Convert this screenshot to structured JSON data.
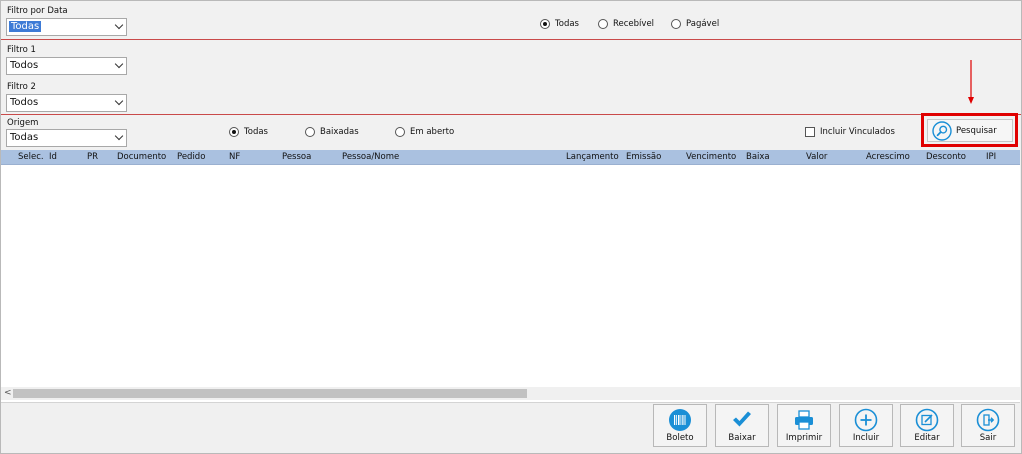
{
  "filters": {
    "filtro_data": {
      "label": "Filtro por Data",
      "value": "Todas"
    },
    "filtro1": {
      "label": "Filtro 1",
      "value": "Todos"
    },
    "filtro2": {
      "label": "Filtro 2",
      "value": "Todos"
    },
    "origem": {
      "label": "Origem",
      "value": "Todas"
    }
  },
  "tipo_radios": [
    {
      "label": "Todas",
      "checked": true
    },
    {
      "label": "Recebível",
      "checked": false
    },
    {
      "label": "Pagável",
      "checked": false
    }
  ],
  "status_radios": [
    {
      "label": "Todas",
      "checked": true
    },
    {
      "label": "Baixadas",
      "checked": false
    },
    {
      "label": "Em aberto",
      "checked": false
    }
  ],
  "incluir_vinculados": {
    "label": "Incluir Vinculados",
    "checked": false
  },
  "search": {
    "label": "Pesquisar",
    "icon": "magnifier-icon"
  },
  "grid": {
    "columns": [
      "Selec.",
      "Id",
      "PR",
      "Documento",
      "Pedido",
      "NF",
      "Pessoa",
      "Pessoa/Nome",
      "Lançamento",
      "Emissão",
      "Vencimento",
      "Baixa",
      "Valor",
      "Acrescimo",
      "Desconto",
      "IPI"
    ],
    "rows": []
  },
  "scroll_arrow": "<",
  "actions": [
    {
      "label": "Boleto",
      "icon": "barcode-icon"
    },
    {
      "label": "Baixar",
      "icon": "check-icon"
    },
    {
      "label": "Imprimir",
      "icon": "printer-icon"
    },
    {
      "label": "Incluir",
      "icon": "plus-icon"
    },
    {
      "label": "Editar",
      "icon": "edit-icon"
    },
    {
      "label": "Sair",
      "icon": "exit-icon"
    }
  ],
  "colors": {
    "accent": "#1a8fd6",
    "header_bg": "#aac1e0",
    "highlight": "#e00000",
    "separator": "#c94a4a"
  }
}
